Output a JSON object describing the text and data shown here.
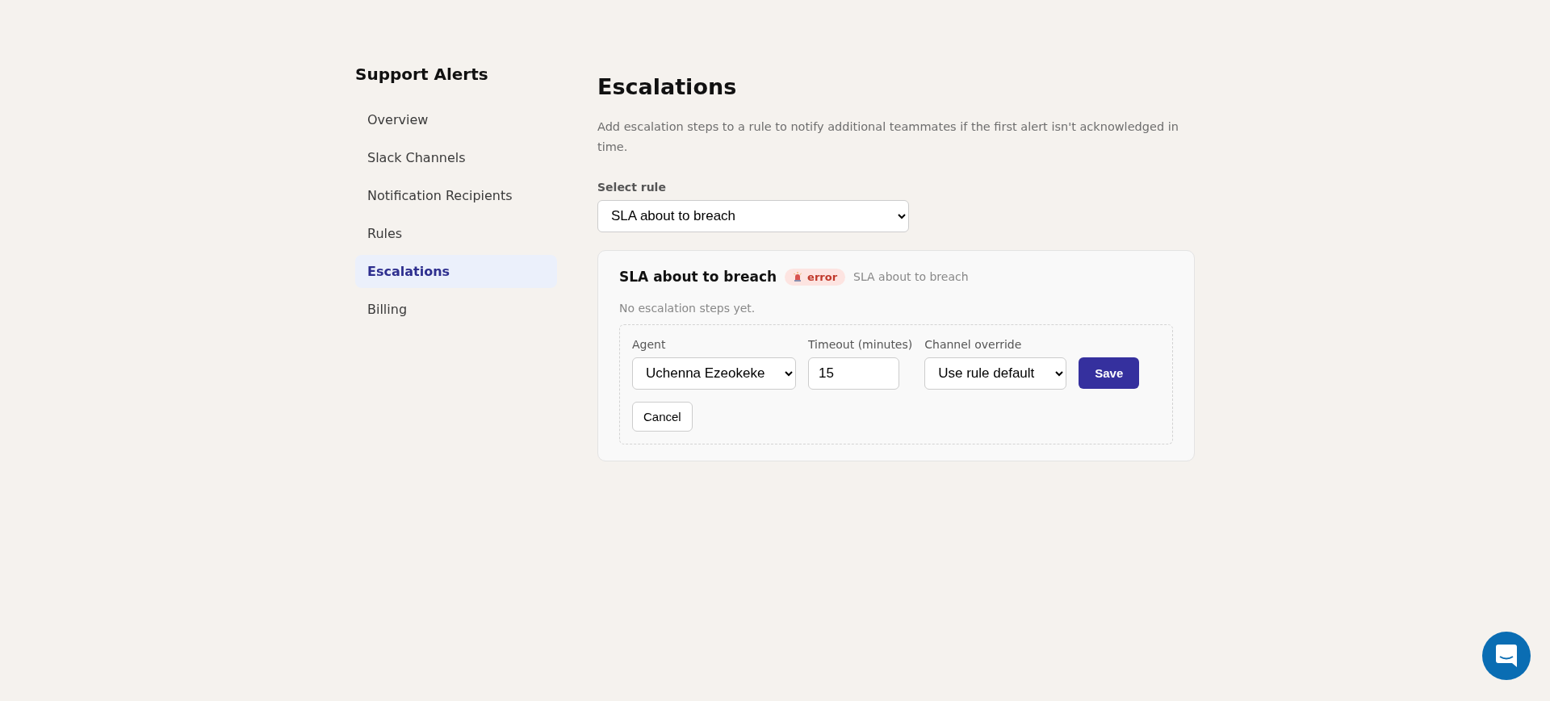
{
  "sidebar": {
    "title": "Support Alerts",
    "items": [
      {
        "label": "Overview",
        "selected": false
      },
      {
        "label": "Slack Channels",
        "selected": false
      },
      {
        "label": "Notification Recipients",
        "selected": false
      },
      {
        "label": "Rules",
        "selected": false
      },
      {
        "label": "Escalations",
        "selected": true
      },
      {
        "label": "Billing",
        "selected": false
      }
    ]
  },
  "page": {
    "title": "Escalations",
    "description": "Add escalation steps to a rule to notify additional teammates if the first alert isn't acknowledged in time.",
    "rule_select": {
      "label": "Select rule",
      "value": "SLA about to breach"
    }
  },
  "rule_card": {
    "title": "SLA about to breach",
    "severity": {
      "label": "error",
      "kind": "error"
    },
    "subtitle": "SLA about to breach",
    "empty_text": "No escalation steps yet.",
    "form": {
      "agent": {
        "label": "Agent",
        "value": "Uchenna Ezeokeke"
      },
      "timeout": {
        "label": "Timeout (minutes)",
        "value": "15"
      },
      "channel": {
        "label": "Channel override",
        "value": "Use rule default"
      },
      "save": "Save",
      "cancel": "Cancel"
    }
  }
}
